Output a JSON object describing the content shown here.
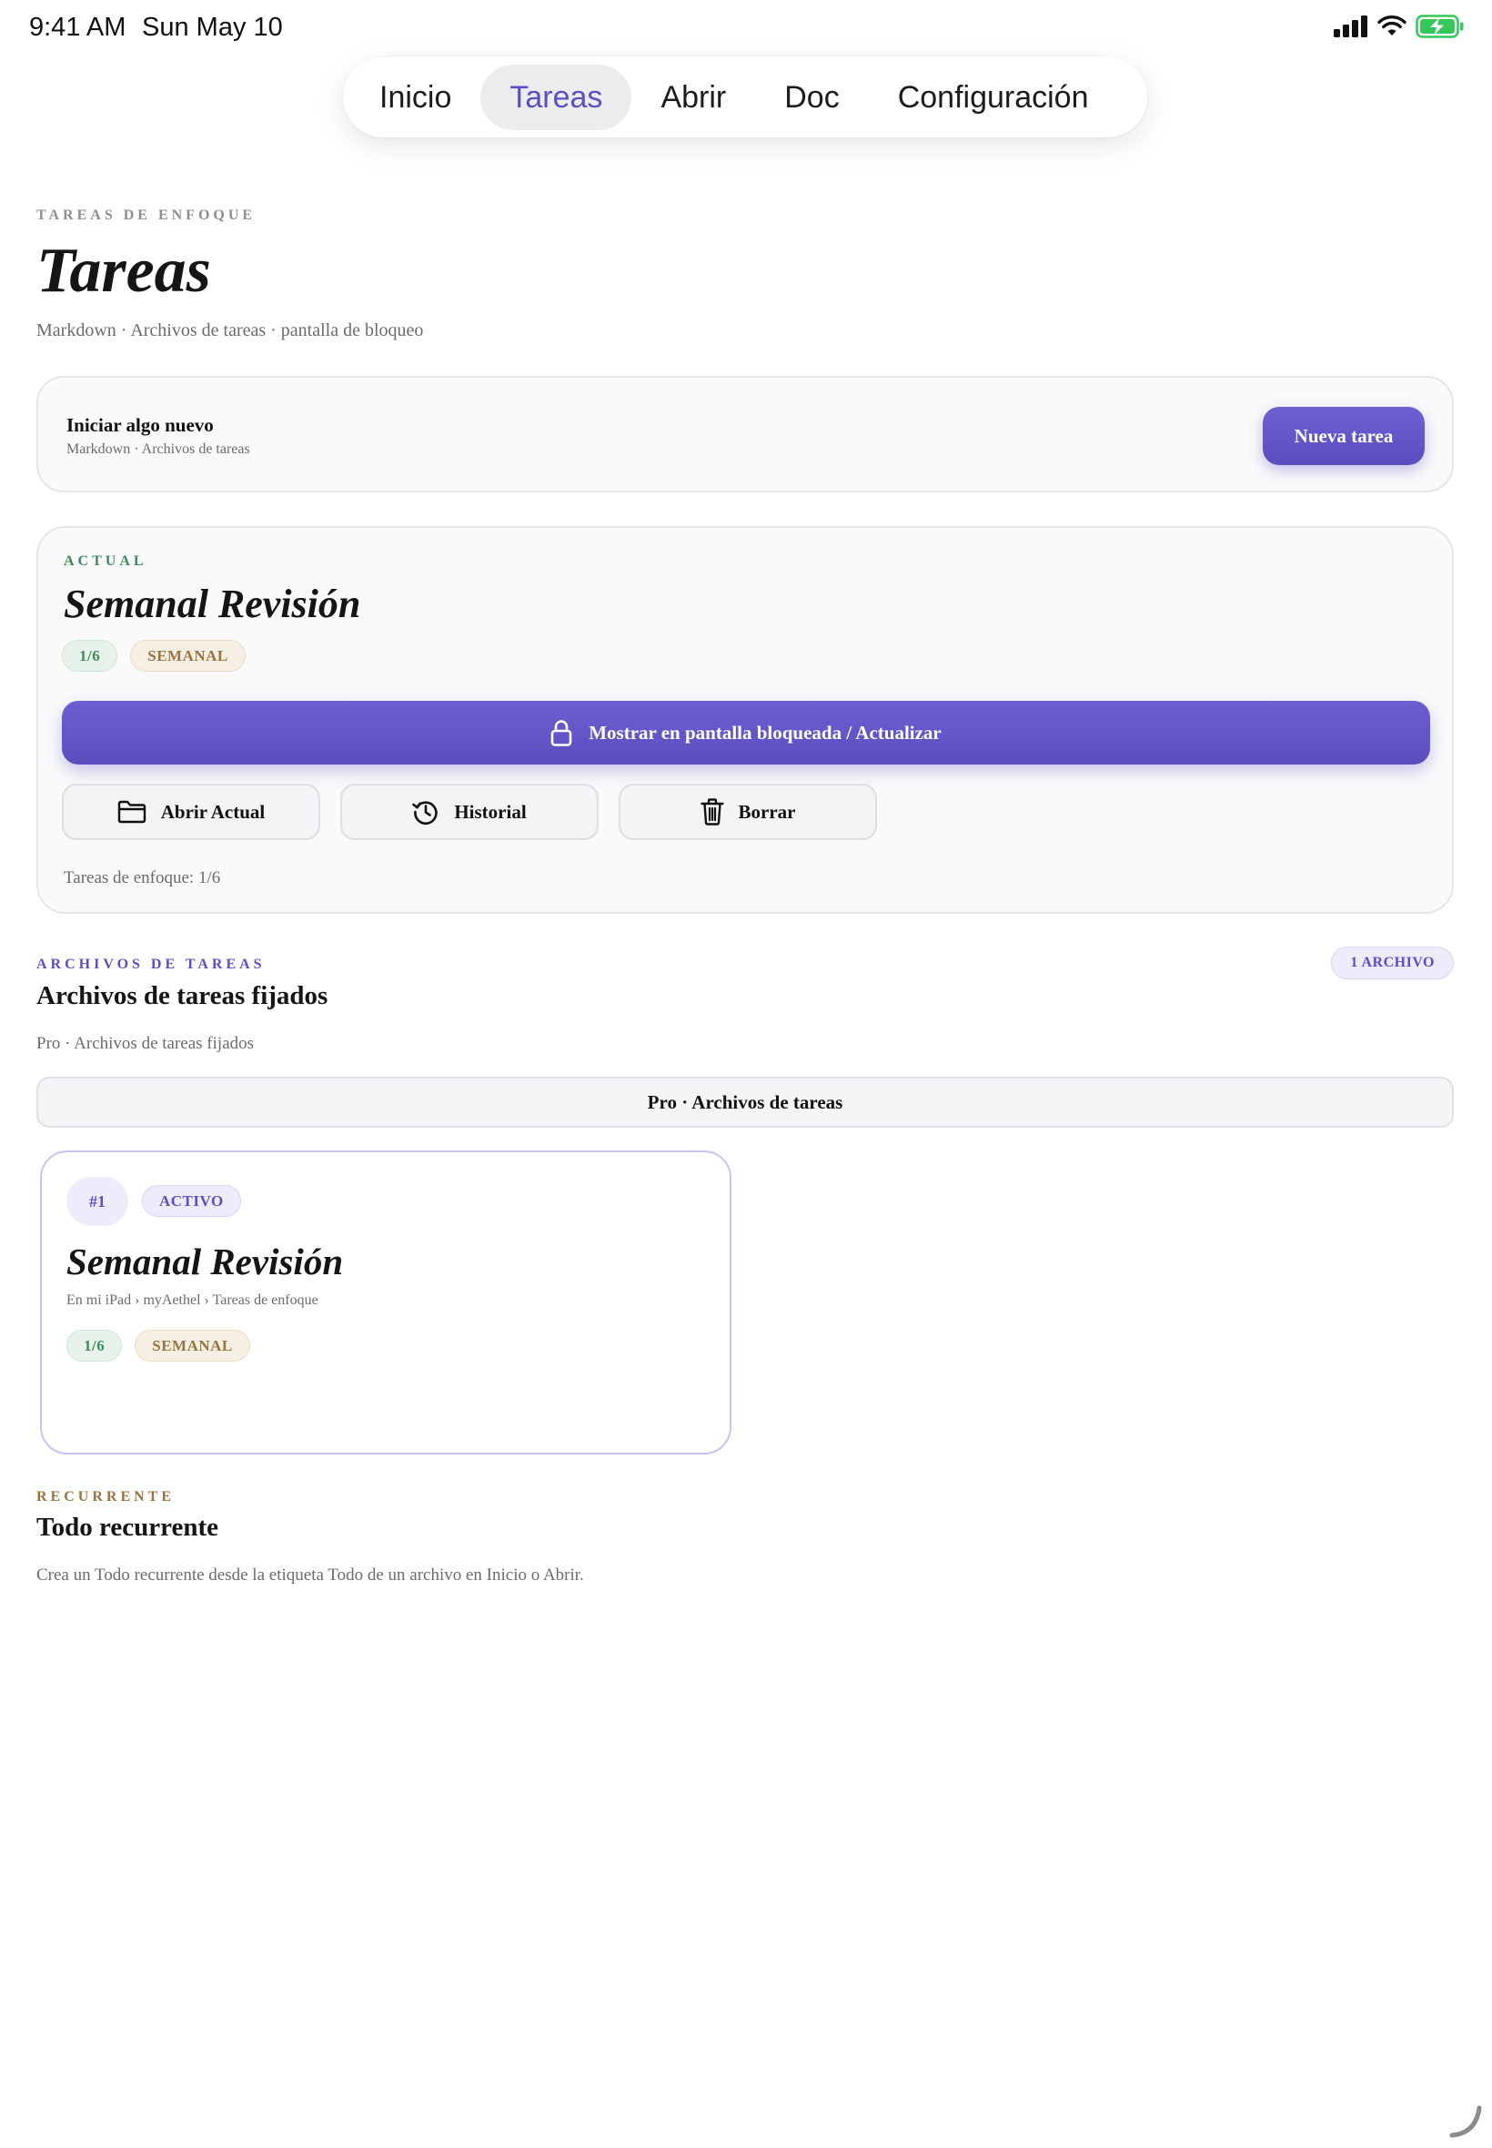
{
  "status": {
    "time": "9:41 AM",
    "date": "Sun May 10"
  },
  "tabs": [
    {
      "label": "Inicio"
    },
    {
      "label": "Tareas"
    },
    {
      "label": "Abrir"
    },
    {
      "label": "Doc"
    },
    {
      "label": "Configuración"
    }
  ],
  "header": {
    "overline": "TAREAS DE ENFOQUE",
    "title": "Tareas",
    "subtitle": "Markdown · Archivos de tareas · pantalla de bloqueo"
  },
  "new_task": {
    "title": "Iniciar algo nuevo",
    "subtitle": "Markdown · Archivos de tareas",
    "button": "Nueva tarea"
  },
  "current": {
    "overline": "ACTUAL",
    "title": "Semanal Revisión",
    "progress": "1/6",
    "period": "SEMANAL",
    "lock_button": "Mostrar en pantalla bloqueada / Actualizar",
    "open_button": "Abrir Actual",
    "history_button": "Historial",
    "delete_button": "Borrar",
    "footer": "Tareas de enfoque: 1/6"
  },
  "files": {
    "overline": "ARCHIVOS DE TAREAS",
    "count_badge": "1 ARCHIVO",
    "title": "Archivos de tareas fijados",
    "subtitle": "Pro · Archivos de tareas fijados",
    "pro_bar": "Pro · Archivos de tareas",
    "items": [
      {
        "number": "#1",
        "status": "ACTIVO",
        "title": "Semanal Revisión",
        "path": "En mi iPad › myAethel › Tareas de enfoque",
        "progress": "1/6",
        "period": "SEMANAL"
      }
    ]
  },
  "recurring": {
    "overline": "RECURRENTE",
    "title": "Todo recurrente",
    "subtitle": "Crea un Todo recurrente desde la etiqueta Todo de un archivo en Inicio o Abrir."
  },
  "colors": {
    "accent": "#5b4fc4",
    "green": "#3f8a5c",
    "tan": "#9a7440",
    "battery": "#34c759"
  },
  "icons": {
    "lock": "lock-icon",
    "folder": "folder-icon",
    "history": "history-icon",
    "trash": "trash-icon"
  }
}
